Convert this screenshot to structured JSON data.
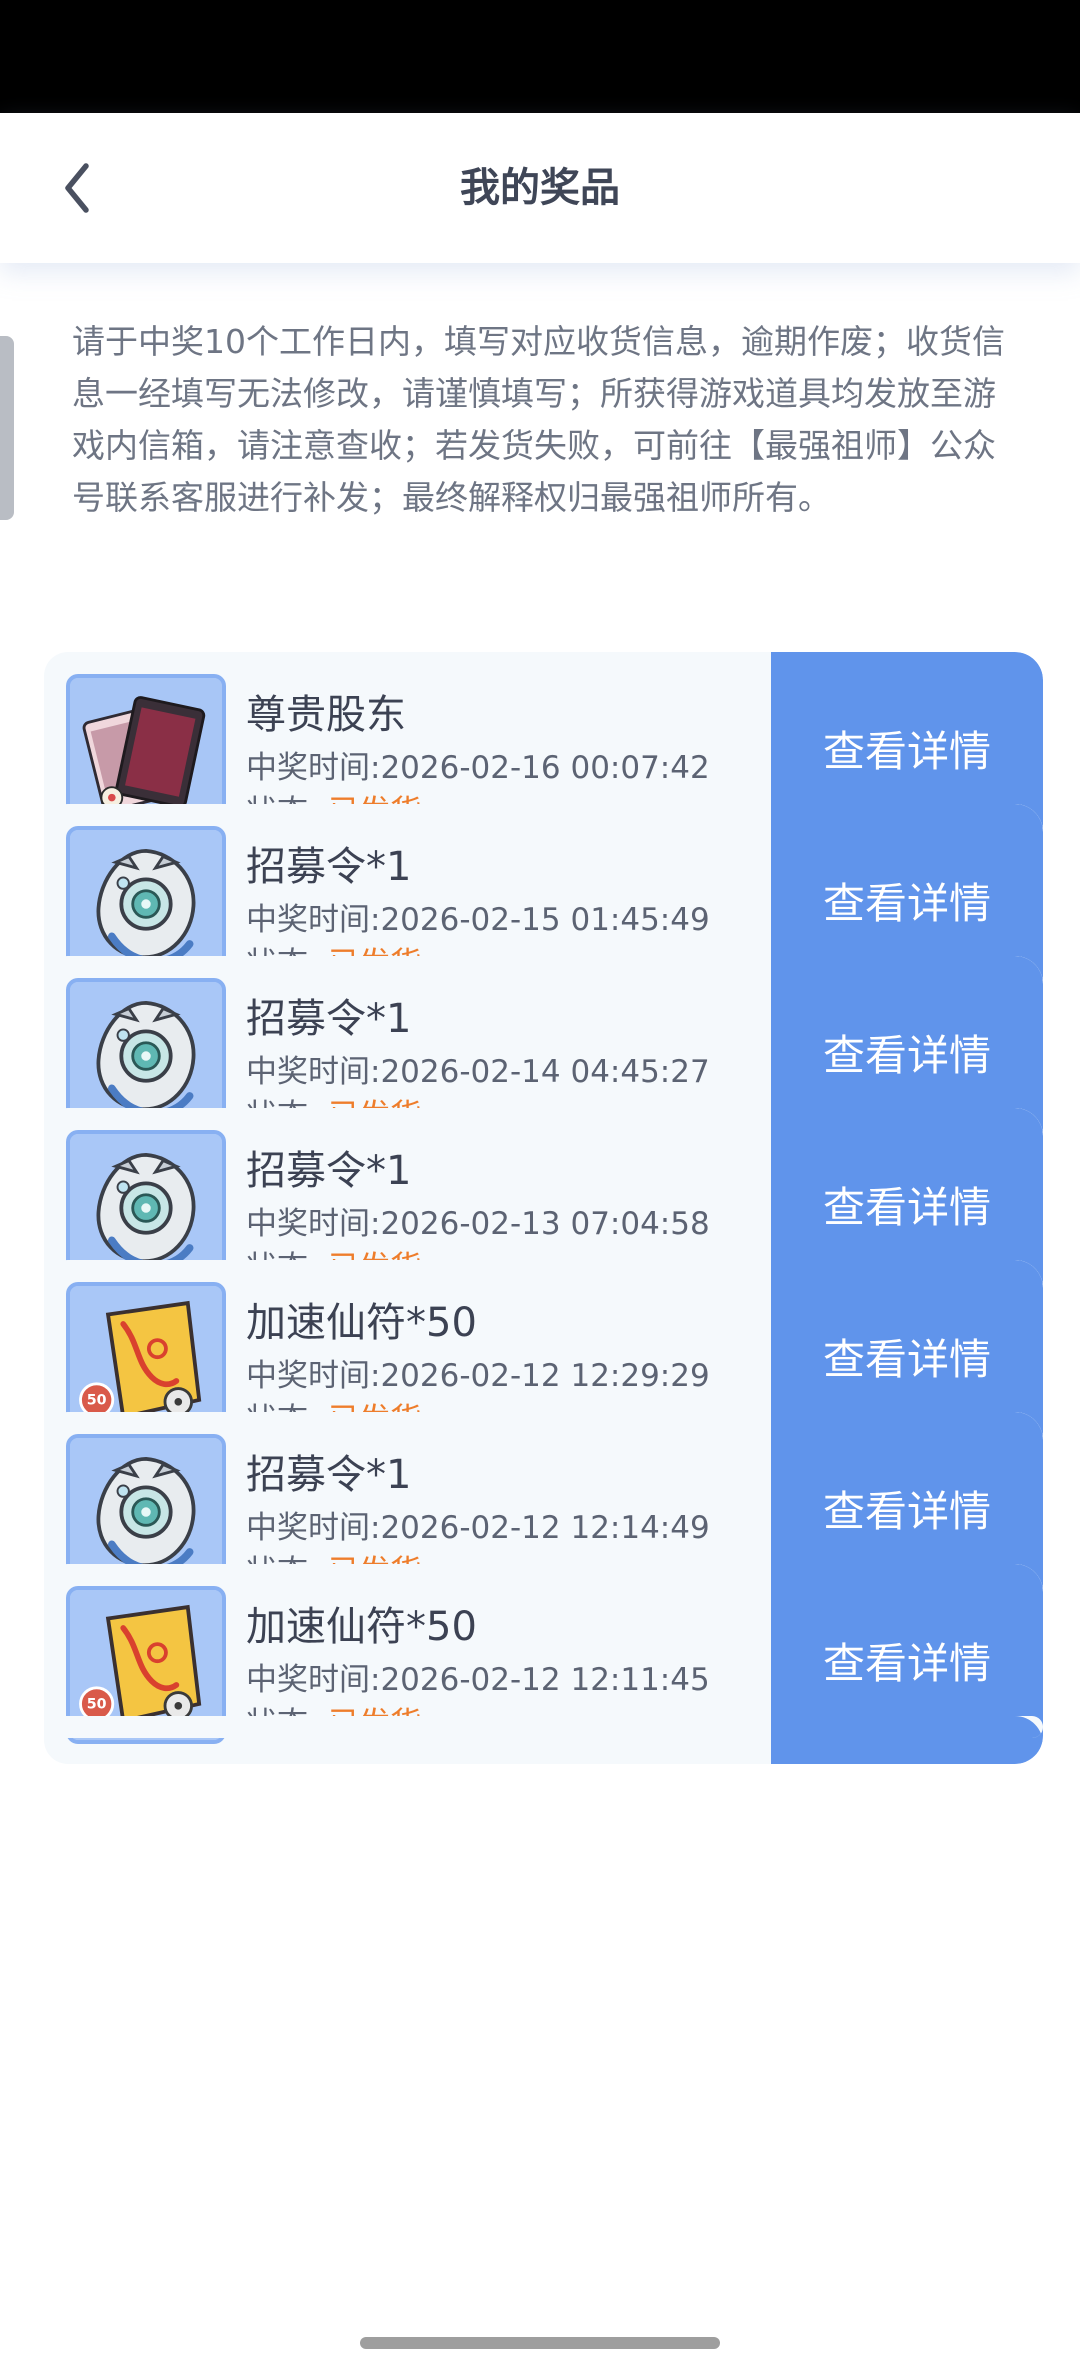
{
  "header": {
    "title": "我的奖品",
    "back_icon": "chevron-left-icon"
  },
  "notice": "请于中奖10个工作日内，填写对应收货信息，逾期作废；收货信息一经填写无法修改，请谨慎填写；所获得游戏道具均发放至游戏内信箱，请注意查收；若发货失败，可前往【最强祖师】公众号联系客服进行补发；最终解释权归最强祖师所有。",
  "colors": {
    "accent": "#6094eb",
    "status": "#ee7d2b"
  },
  "prizes": [
    {
      "name": "尊贵股东",
      "time_label": "中奖时间:",
      "time": "2026-02-16 00:07:42",
      "status_label": "状态: ",
      "status": "已发货",
      "button": "查看详情",
      "icon": "shareholder-card-icon"
    },
    {
      "name": "招募令*1",
      "time_label": "中奖时间:",
      "time": "2026-02-15 01:45:49",
      "status_label": "状态: ",
      "status": "已发货",
      "button": "查看详情",
      "icon": "recruit-token-icon"
    },
    {
      "name": "招募令*1",
      "time_label": "中奖时间:",
      "time": "2026-02-14 04:45:27",
      "status_label": "状态: ",
      "status": "已发货",
      "button": "查看详情",
      "icon": "recruit-token-icon"
    },
    {
      "name": "招募令*1",
      "time_label": "中奖时间:",
      "time": "2026-02-13 07:04:58",
      "status_label": "状态: ",
      "status": "已发货",
      "button": "查看详情",
      "icon": "recruit-token-icon"
    },
    {
      "name": "加速仙符*50",
      "time_label": "中奖时间:",
      "time": "2026-02-12 12:29:29",
      "status_label": "状态: ",
      "status": "已发货",
      "button": "查看详情",
      "icon": "speedup-talisman-icon",
      "badge": "50"
    },
    {
      "name": "招募令*1",
      "time_label": "中奖时间:",
      "time": "2026-02-12 12:14:49",
      "status_label": "状态: ",
      "status": "已发货",
      "button": "查看详情",
      "icon": "recruit-token-icon"
    },
    {
      "name": "加速仙符*50",
      "time_label": "中奖时间:",
      "time": "2026-02-12 12:11:45",
      "status_label": "状态: ",
      "status": "已发货",
      "button": "查看详情",
      "icon": "speedup-talisman-icon",
      "badge": "50"
    }
  ]
}
